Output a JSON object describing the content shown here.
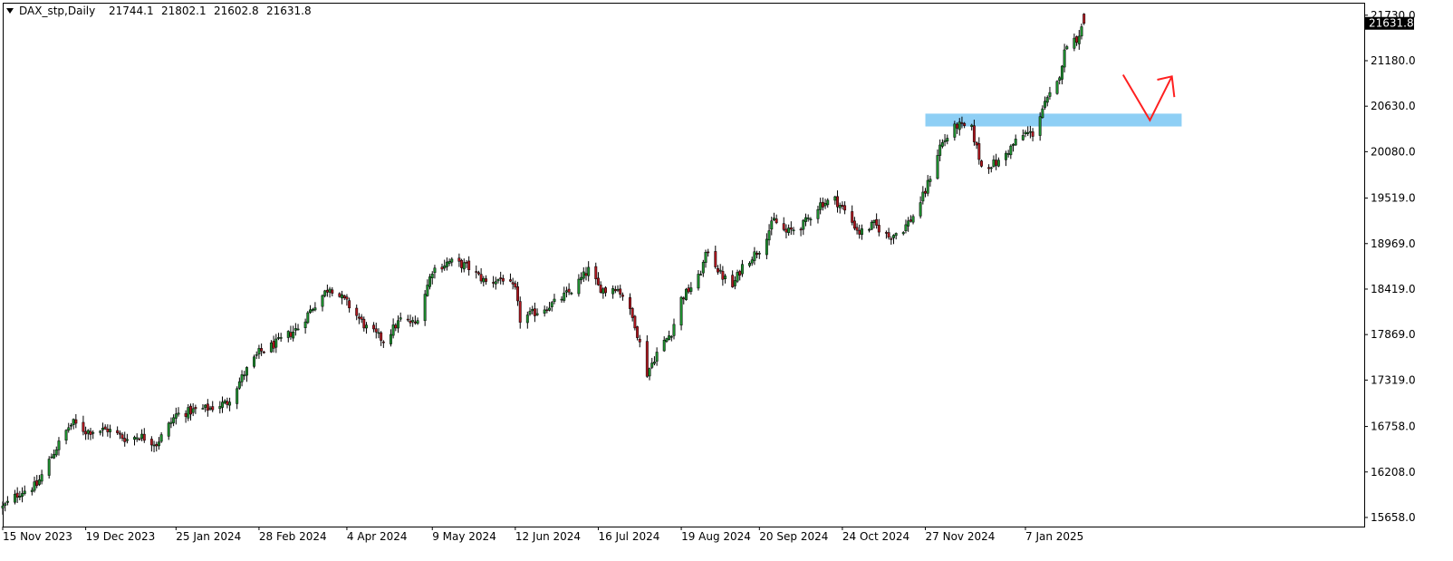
{
  "header": {
    "symbol_label": "DAX_stp,Daily",
    "open": "21744.1",
    "high": "21802.1",
    "low": "21602.8",
    "close": "21631.8"
  },
  "colors": {
    "bull": "#1e8f2f",
    "bear": "#b0171f",
    "wick": "#000000",
    "zone": "#8ecff5",
    "arrow": "#ff2020",
    "price_tag_bg": "#000000",
    "price_tag_text": "#ffffff"
  },
  "chart_data": {
    "type": "candlestick",
    "y_ticks": [
      "21730.0",
      "21180.0",
      "20630.0",
      "20080.0",
      "19519.0",
      "18969.0",
      "18419.0",
      "17869.0",
      "17319.0",
      "16758.0",
      "16208.0",
      "15658.0"
    ],
    "x_ticks": [
      "15 Nov 2023",
      "19 Dec 2023",
      "25 Jan 2024",
      "28 Feb 2024",
      "4 Apr 2024",
      "9 May 2024",
      "12 Jun 2024",
      "16 Jul 2024",
      "19 Aug 2024",
      "20 Sep 2024",
      "24 Oct 2024",
      "27 Nov 2024",
      "7 Jan 2025"
    ],
    "last_price_label": "21631.8",
    "ylim": [
      15548,
      21870
    ],
    "close_path": [
      [
        "2023-11-15",
        15780
      ],
      [
        "2023-11-22",
        15960
      ],
      [
        "2023-11-29",
        16050
      ],
      [
        "2023-12-05",
        16400
      ],
      [
        "2023-12-12",
        16750
      ],
      [
        "2023-12-14",
        16800
      ],
      [
        "2023-12-19",
        16700
      ],
      [
        "2023-12-28",
        16720
      ],
      [
        "2024-01-05",
        16600
      ],
      [
        "2024-01-10",
        16650
      ],
      [
        "2024-01-17",
        16550
      ],
      [
        "2024-01-25",
        16900
      ],
      [
        "2024-02-01",
        16950
      ],
      [
        "2024-02-08",
        16980
      ],
      [
        "2024-02-15",
        17050
      ],
      [
        "2024-02-22",
        17400
      ],
      [
        "2024-02-28",
        17650
      ],
      [
        "2024-03-07",
        17780
      ],
      [
        "2024-03-15",
        17950
      ],
      [
        "2024-03-21",
        18200
      ],
      [
        "2024-03-28",
        18450
      ],
      [
        "2024-04-04",
        18250
      ],
      [
        "2024-04-12",
        17950
      ],
      [
        "2024-04-19",
        17800
      ],
      [
        "2024-04-26",
        18050
      ],
      [
        "2024-05-02",
        18000
      ],
      [
        "2024-05-09",
        18650
      ],
      [
        "2024-05-16",
        18750
      ],
      [
        "2024-05-23",
        18700
      ],
      [
        "2024-05-31",
        18500
      ],
      [
        "2024-06-07",
        18550
      ],
      [
        "2024-06-12",
        18400
      ],
      [
        "2024-06-14",
        18050
      ],
      [
        "2024-06-21",
        18150
      ],
      [
        "2024-06-28",
        18250
      ],
      [
        "2024-07-05",
        18400
      ],
      [
        "2024-07-12",
        18650
      ],
      [
        "2024-07-16",
        18450
      ],
      [
        "2024-07-19",
        18400
      ],
      [
        "2024-07-23",
        18450
      ],
      [
        "2024-07-26",
        18350
      ],
      [
        "2024-07-31",
        18000
      ],
      [
        "2024-08-05",
        17400
      ],
      [
        "2024-08-09",
        17650
      ],
      [
        "2024-08-15",
        17900
      ],
      [
        "2024-08-19",
        18300
      ],
      [
        "2024-08-26",
        18550
      ],
      [
        "2024-08-30",
        18900
      ],
      [
        "2024-09-04",
        18600
      ],
      [
        "2024-09-09",
        18450
      ],
      [
        "2024-09-13",
        18700
      ],
      [
        "2024-09-20",
        18900
      ],
      [
        "2024-09-26",
        19250
      ],
      [
        "2024-10-01",
        19100
      ],
      [
        "2024-10-08",
        19200
      ],
      [
        "2024-10-15",
        19450
      ],
      [
        "2024-10-21",
        19500
      ],
      [
        "2024-10-24",
        19400
      ],
      [
        "2024-10-31",
        19100
      ],
      [
        "2024-11-06",
        19200
      ],
      [
        "2024-11-12",
        19050
      ],
      [
        "2024-11-18",
        19150
      ],
      [
        "2024-11-22",
        19300
      ],
      [
        "2024-11-27",
        19600
      ],
      [
        "2024-12-03",
        20150
      ],
      [
        "2024-12-10",
        20400
      ],
      [
        "2024-12-16",
        20350
      ],
      [
        "2024-12-20",
        19900
      ],
      [
        "2024-12-27",
        19950
      ],
      [
        "2025-01-03",
        20200
      ],
      [
        "2025-01-07",
        20300
      ],
      [
        "2025-01-10",
        20300
      ],
      [
        "2025-01-14",
        20600
      ],
      [
        "2025-01-20",
        20900
      ],
      [
        "2025-01-24",
        21400
      ],
      [
        "2025-01-28",
        21450
      ],
      [
        "2025-01-31",
        21631.8
      ]
    ],
    "zone": {
      "start": "2024-11-27",
      "end": "2025-03-12",
      "y_low": 20385,
      "y_high": 20540
    },
    "arrow_path": [
      {
        "date": "2025-02-16",
        "value": 21010
      },
      {
        "date": "2025-02-27",
        "value": 20460
      },
      {
        "date": "2025-03-08",
        "value": 20990
      }
    ],
    "arrow_head": [
      {
        "date": "2025-03-02",
        "value": 20950
      },
      {
        "date": "2025-03-08",
        "value": 20990
      },
      {
        "date": "2025-03-09",
        "value": 20740
      }
    ]
  }
}
